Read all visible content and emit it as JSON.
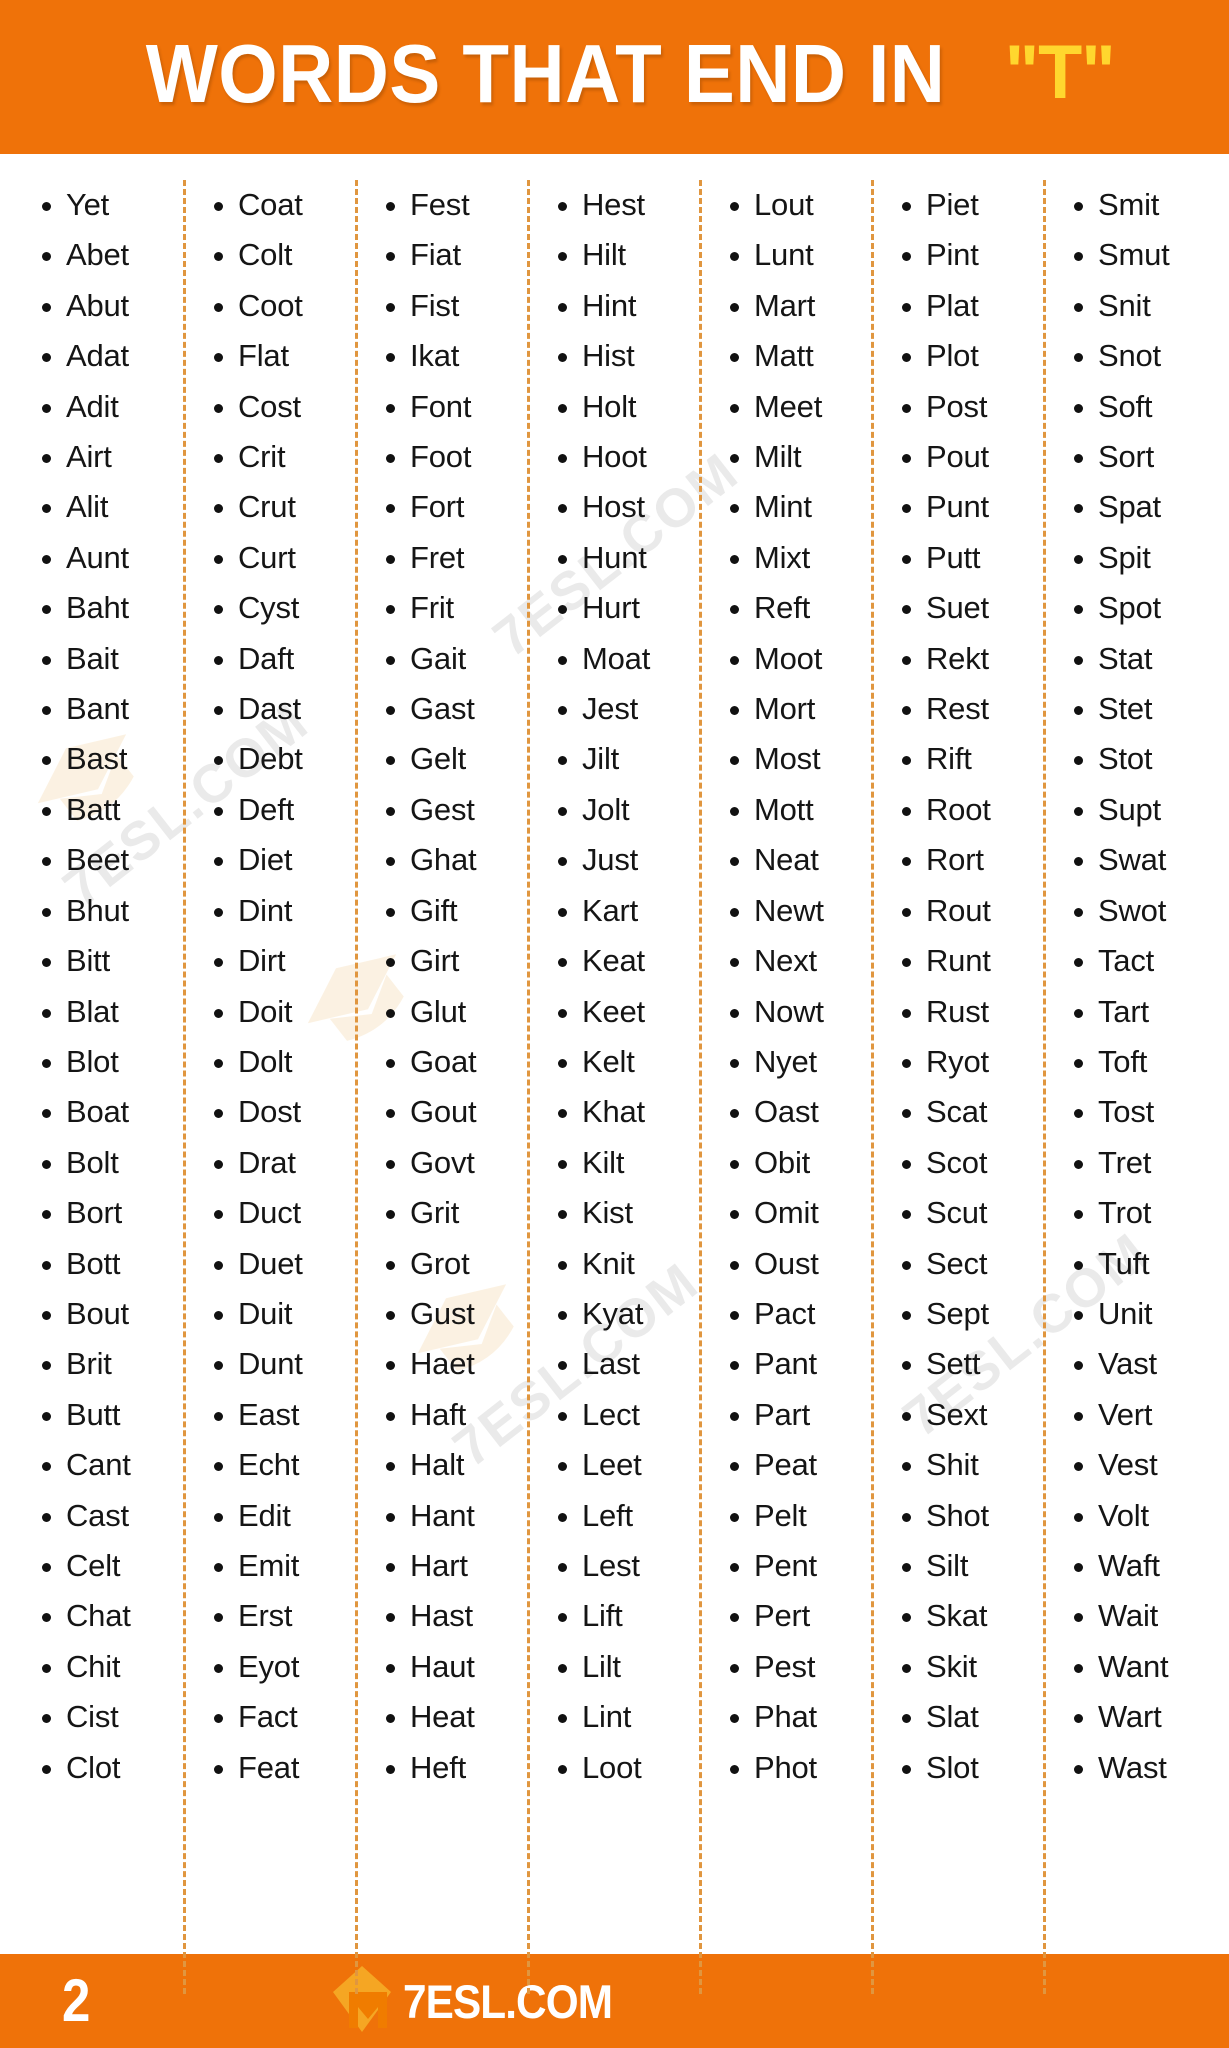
{
  "header": {
    "title_main": "WORDS THAT END IN",
    "title_accent": "\"T\"",
    "background_color": "#ef7209",
    "accent_color": "#ffd72e"
  },
  "watermarks": {
    "text": "7ESL.COM",
    "icon": "graduation-cap-icon"
  },
  "footer": {
    "page_number": "2",
    "brand_text": "7ESL.COM",
    "brand_icon": "7esl-diamond-logo",
    "background_color": "#ef7209"
  },
  "columns": [
    {
      "index": 1,
      "words": [
        "Yet",
        "Abet",
        "Abut",
        "Adat",
        "Adit",
        "Airt",
        "Alit",
        "Aunt",
        "Baht",
        "Bait",
        "Bant",
        "Bast",
        "Batt",
        "Beet",
        "Bhut",
        "Bitt",
        "Blat",
        "Blot",
        "Boat",
        "Bolt",
        "Bort",
        "Bott",
        "Bout",
        "Brit",
        "Butt",
        "Cant",
        "Cast",
        "Celt",
        "Chat",
        "Chit",
        "Cist",
        "Clot"
      ]
    },
    {
      "index": 2,
      "words": [
        "Coat",
        "Colt",
        "Coot",
        "Flat",
        "Cost",
        "Crit",
        "Crut",
        "Curt",
        "Cyst",
        "Daft",
        "Dast",
        "Debt",
        "Deft",
        "Diet",
        "Dint",
        "Dirt",
        "Doit",
        "Dolt",
        "Dost",
        "Drat",
        "Duct",
        "Duet",
        "Duit",
        "Dunt",
        "East",
        "Echt",
        "Edit",
        "Emit",
        "Erst",
        "Eyot",
        "Fact",
        "Feat"
      ]
    },
    {
      "index": 3,
      "words": [
        "Fest",
        "Fiat",
        "Fist",
        "Ikat",
        "Font",
        "Foot",
        "Fort",
        "Fret",
        "Frit",
        "Gait",
        "Gast",
        "Gelt",
        "Gest",
        "Ghat",
        "Gift",
        "Girt",
        "Glut",
        "Goat",
        "Gout",
        "Govt",
        "Grit",
        "Grot",
        "Gust",
        "Haet",
        "Haft",
        "Halt",
        "Hant",
        "Hart",
        "Hast",
        "Haut",
        "Heat",
        "Heft"
      ]
    },
    {
      "index": 4,
      "words": [
        "Hest",
        "Hilt",
        "Hint",
        "Hist",
        "Holt",
        "Hoot",
        "Host",
        "Hunt",
        "Hurt",
        "Moat",
        "Jest",
        "Jilt",
        "Jolt",
        "Just",
        "Kart",
        "Keat",
        "Keet",
        "Kelt",
        "Khat",
        "Kilt",
        "Kist",
        "Knit",
        "Kyat",
        "Last",
        "Lect",
        "Leet",
        "Left",
        "Lest",
        "Lift",
        "Lilt",
        "Lint",
        "Loot"
      ]
    },
    {
      "index": 5,
      "words": [
        "Lout",
        "Lunt",
        "Mart",
        "Matt",
        "Meet",
        "Milt",
        "Mint",
        "Mixt",
        "Reft",
        "Moot",
        "Mort",
        "Most",
        "Mott",
        "Neat",
        "Newt",
        "Next",
        "Nowt",
        "Nyet",
        "Oast",
        "Obit",
        "Omit",
        "Oust",
        "Pact",
        "Pant",
        "Part",
        "Peat",
        "Pelt",
        "Pent",
        "Pert",
        "Pest",
        "Phat",
        "Phot"
      ]
    },
    {
      "index": 6,
      "words": [
        "Piet",
        "Pint",
        "Plat",
        "Plot",
        "Post",
        "Pout",
        "Punt",
        "Putt",
        "Suet",
        "Rekt",
        "Rest",
        "Rift",
        "Root",
        "Rort",
        "Rout",
        "Runt",
        "Rust",
        "Ryot",
        "Scat",
        "Scot",
        "Scut",
        "Sect",
        "Sept",
        "Sett",
        "Sext",
        "Shit",
        "Shot",
        "Silt",
        "Skat",
        "Skit",
        "Slat",
        "Slot"
      ]
    },
    {
      "index": 7,
      "words": [
        "Smit",
        "Smut",
        "Snit",
        "Snot",
        "Soft",
        "Sort",
        "Spat",
        "Spit",
        "Spot",
        "Stat",
        "Stet",
        "Stot",
        "Supt",
        "Swat",
        "Swot",
        "Tact",
        "Tart",
        "Toft",
        "Tost",
        "Tret",
        "Trot",
        "Tuft",
        "Unit",
        "Vast",
        "Vert",
        "Vest",
        "Volt",
        "Waft",
        "Wait",
        "Want",
        "Wart",
        "Wast"
      ]
    }
  ]
}
